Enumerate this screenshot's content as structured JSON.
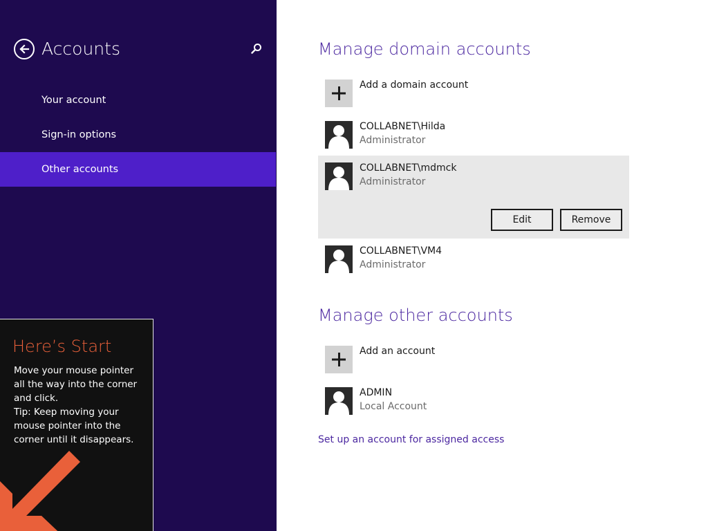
{
  "sidebar": {
    "title": "Accounts",
    "items": [
      {
        "label": "Your account",
        "selected": false
      },
      {
        "label": "Sign-in options",
        "selected": false
      },
      {
        "label": "Other accounts",
        "selected": true
      }
    ]
  },
  "tip": {
    "title": "Here’s Start",
    "body": "Move your mouse pointer\nall the way into the corner\nand click.\nTip: Keep moving your\nmouse pointer into the\ncorner until it disappears."
  },
  "domain_section": {
    "title": "Manage domain accounts",
    "add_label": "Add a domain account",
    "accounts": [
      {
        "name": "COLLABNET\\Hilda",
        "role": "Administrator"
      },
      {
        "name": "COLLABNET\\mdmck",
        "role": "Administrator"
      },
      {
        "name": "COLLABNET\\VM4",
        "role": "Administrator"
      }
    ],
    "edit_label": "Edit",
    "remove_label": "Remove"
  },
  "other_section": {
    "title": "Manage other accounts",
    "add_label": "Add an account",
    "accounts": [
      {
        "name": "ADMIN",
        "role": "Local Account"
      }
    ]
  },
  "assigned_access_link": "Set up an account for assigned access",
  "colors": {
    "sidebar_bg": "#1e0a4f",
    "selected_nav": "#4e1fc9",
    "accent_text": "#4b27a0",
    "tip_title": "#e9603a",
    "arrow": "#e9603a"
  },
  "icons": {
    "back": "back-arrow-circle-icon",
    "search": "search-icon",
    "add": "plus-icon",
    "user": "user-silhouette-icon",
    "tip_arrow": "arrow-down-left-icon"
  }
}
